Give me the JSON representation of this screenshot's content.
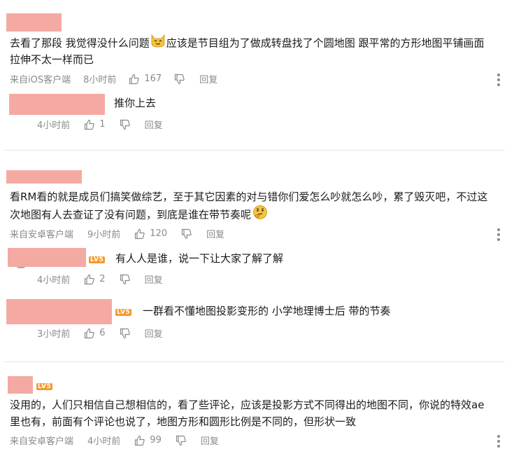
{
  "colors": {
    "name_block": "#f4aaa2",
    "meta": "#8a8a8a",
    "badge": "#f39a2e"
  },
  "comments": [
    {
      "text_line1": "去看了那段 我觉得没什么问题",
      "text_line1_after": "应该是节目组为了做成转盘找了个圆地图 跟平常的方形地图平铺画面",
      "text_line2": "拉伸不太一样而已",
      "emoji": "cat-face-icon",
      "source": "来自iOS客户端",
      "time": "8小时前",
      "likes": "167",
      "reply": "回复",
      "replies": [
        {
          "text": "推你上去",
          "time": "4小时前",
          "likes": "1",
          "reply": "回复"
        }
      ]
    },
    {
      "text_line1": "看RM看的就是成员们搞笑做综艺，至于其它因素的对与错你们爱怎么吵就怎么吵，累了毁灭吧，不过这",
      "text_line2": "次地图有人去查证了没有问题，到底是谁在带节奏呢",
      "emoji": "thinking-face-icon",
      "source": "来自安卓客户端",
      "time": "9小时前",
      "likes": "120",
      "reply": "回复",
      "replies": [
        {
          "badge": "LV5",
          "text": "有人人是谁，说一下让大家了解了解",
          "time": "4小时前",
          "likes": "2",
          "reply": "回复"
        },
        {
          "badge": "LV5",
          "text": "一群看不懂地图投影变形的 小学地理博士后 带的节奏",
          "time": "3小时前",
          "likes": "6",
          "reply": "回复"
        }
      ]
    },
    {
      "badge": "LV5",
      "text_line1": "没用的，人们只相信自己想相信的，看了些评论，应该是投影方式不同得出的地图不同，你说的特效ae",
      "text_line2": "里也有，前面有个评论也说了，地图方形和圆形比例是不同的，但形状一致",
      "source": "来自安卓客户端",
      "time": "4小时前",
      "likes": "99",
      "reply": "回复"
    }
  ]
}
